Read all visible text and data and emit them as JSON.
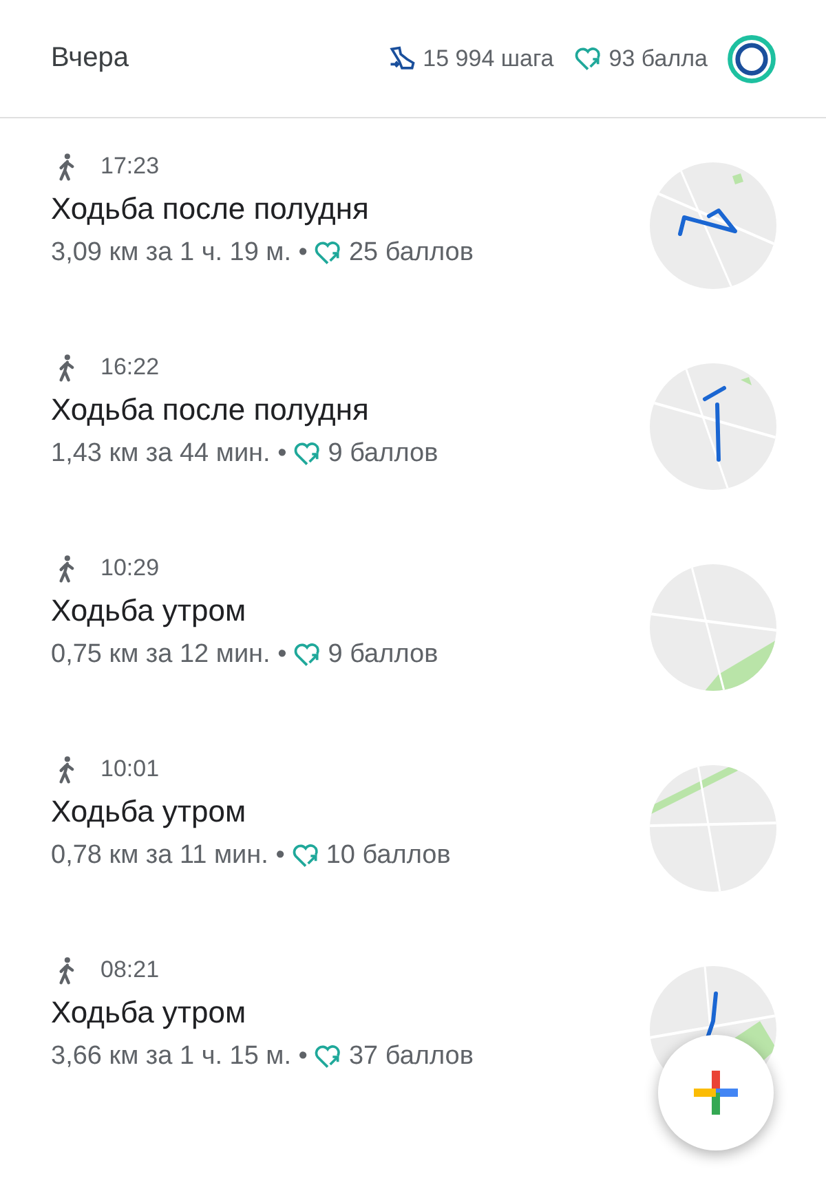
{
  "header": {
    "title": "Вчера",
    "steps": "15 994 шага",
    "points": "93 балла"
  },
  "activities": [
    {
      "time": "17:23",
      "title": "Ходьба после полудня",
      "summary": "3,09 км за 1 ч. 19 м. •",
      "points": "25 баллов"
    },
    {
      "time": "16:22",
      "title": "Ходьба после полудня",
      "summary": "1,43 км за 44 мин. •",
      "points": "9 баллов"
    },
    {
      "time": "10:29",
      "title": "Ходьба утром",
      "summary": "0,75 км за 12 мин. •",
      "points": "9 баллов"
    },
    {
      "time": "10:01",
      "title": "Ходьба утром",
      "summary": "0,78 км за 11 мин. •",
      "points": "10 баллов"
    },
    {
      "time": "08:21",
      "title": "Ходьба утром",
      "summary": "3,66 км за 1 ч. 15 м. •",
      "points": "37 баллов"
    }
  ]
}
